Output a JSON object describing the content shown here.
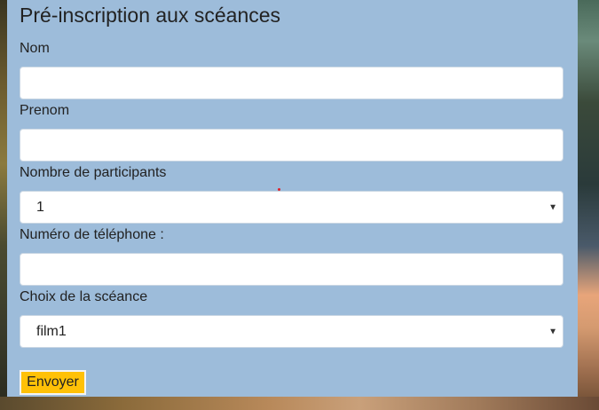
{
  "form": {
    "title": "Pré-inscription aux scéances",
    "fields": {
      "nom": {
        "label": "Nom",
        "value": ""
      },
      "prenom": {
        "label": "Prenom",
        "value": ""
      },
      "participants": {
        "label": "Nombre de participants",
        "selected": "1"
      },
      "telephone": {
        "label": "Numéro de téléphone :",
        "value": ""
      },
      "seance": {
        "label": "Choix de la scéance",
        "selected": "film1"
      }
    },
    "submit_label": "Envoyer"
  },
  "colors": {
    "panel": "#9dbcda",
    "button": "#ffc107"
  },
  "icons": {
    "select_arrow": "chevron-down-icon"
  }
}
